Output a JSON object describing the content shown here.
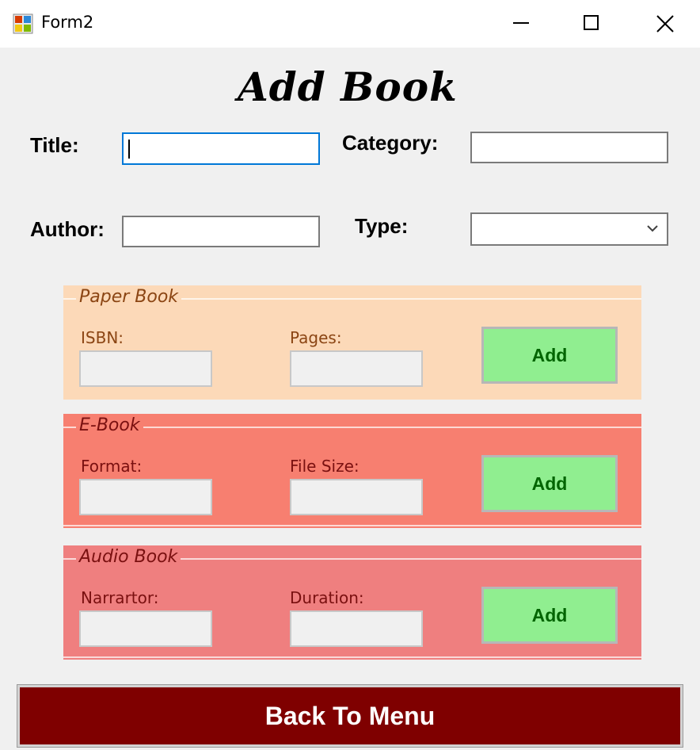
{
  "window": {
    "title": "Form2",
    "icon": "winforms-app-icon",
    "controls": [
      "minimize-icon",
      "maximize-icon",
      "close-icon"
    ]
  },
  "heading": "Add Book",
  "fields": {
    "title_label": "Title:",
    "title_value": "",
    "category_label": "Category:",
    "category_value": "",
    "author_label": "Author:",
    "author_value": "",
    "type_label": "Type:",
    "type_selected": ""
  },
  "groups": {
    "paper": {
      "legend": "Paper Book",
      "field1_label": "ISBN:",
      "field2_label": "Pages:",
      "add_label": "Add",
      "color": "#fcd9b8",
      "text_color": "#8b4513"
    },
    "ebook": {
      "legend": "E-Book",
      "field1_label": "Format:",
      "field2_label": "File Size:",
      "add_label": "Add",
      "color": "#f77f70",
      "text_color": "#7a1010"
    },
    "audio": {
      "legend": "Audio Book",
      "field1_label": "Narrartor:",
      "field2_label": "Duration:",
      "add_label": "Add",
      "color": "#ef7f7f",
      "text_color": "#7a1010"
    }
  },
  "back_button": "Back To Menu",
  "colors": {
    "form_bg": "#f0f0f0",
    "back_button_bg": "#7f0000",
    "add_button_bg": "#90ee90",
    "add_button_text": "#006400"
  }
}
